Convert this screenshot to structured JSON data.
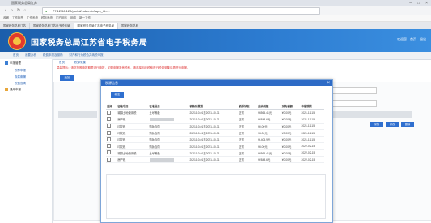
{
  "browser": {
    "window_title": "国家税务总局江苏",
    "url": "77.12.56.120/portal/index.do?app_id=...",
    "bookmarks": [
      "收藏",
      "工作标签",
      "工作系统",
      "税务系统",
      "门户网站",
      "网络",
      "新一工作"
    ],
    "tabs": [
      "国家税务总局江苏",
      "国家税务总局江苏电子税务局",
      "国家税务总局江苏电子税务局",
      "国家税务总局"
    ]
  },
  "header": {
    "site_title": "国家税务总局江苏省电子税务局",
    "right_links": [
      "欢迎您",
      "首页",
      "退出"
    ]
  },
  "nav": [
    "首页",
    "我要办税",
    "税费申报及缴纳",
    "财产和行为税合并纳税申报"
  ],
  "sidebar": {
    "items": [
      {
        "label": "申报管理"
      },
      {
        "label": "税种申报"
      },
      {
        "label": "合并申报"
      },
      {
        "label": "税费查询"
      },
      {
        "label": "通用申报"
      }
    ]
  },
  "subtabs": [
    "首页",
    "税源采集"
  ],
  "tip": "温馨提示：请您按照申报期限进行申报，如需申报其他税种，请选择相应税种进行税源采集后再进行申报。",
  "back_button": "返回",
  "bg_buttons": [
    "采集",
    "修改",
    "删除"
  ],
  "modal": {
    "title": "税源信息",
    "confirm_label": "确定",
    "columns": [
      "选择",
      "征收项目",
      "征收品目",
      "税款所属期",
      "税源状态",
      "应纳税额",
      "减免税额",
      "申报期限"
    ],
    "rows": [
      {
        "item": "城镇土地使用税",
        "sub": "土地等级",
        "period": "2021-10-01至2021-10-31",
        "status": "正常",
        "tax": "¥3564.41元",
        "relief": "¥0.00元",
        "deadline": "2021-11-15"
      },
      {
        "item": "房产税",
        "sub": "",
        "period": "2021-10-01至2021-10-31",
        "status": "正常",
        "tax": "¥2848.6元",
        "relief": "¥0.00元",
        "deadline": "2021-11-15"
      },
      {
        "item": "印花税",
        "sub": "购销合同",
        "period": "2021-10-01至2021-10-31",
        "status": "正常",
        "tax": "¥0.00元",
        "relief": "¥0.00元",
        "deadline": "2021-11-15"
      },
      {
        "item": "印花税",
        "sub": "购销合同",
        "period": "2021-10-01至2021-10-31",
        "status": "正常",
        "tax": "¥4.00元",
        "relief": "¥0.00元",
        "deadline": "2021-11-15"
      },
      {
        "item": "印花税",
        "sub": "购销合同",
        "period": "2021-10-01至2021-10-31",
        "status": "正常",
        "tax": "¥1405.9元",
        "relief": "¥0.00元",
        "deadline": "2021-11-15"
      },
      {
        "item": "印花税",
        "sub": "购销合同",
        "period": "2021-10-01至2021-10-31",
        "status": "正常",
        "tax": "¥3.00元",
        "relief": "¥0.00元",
        "deadline": "2022-02-15"
      },
      {
        "item": "城镇土地使用税",
        "sub": "土地等级",
        "period": "2021-10-01至2021-10-31",
        "status": "正常",
        "tax": "¥3564.41元",
        "relief": "¥0.00元",
        "deadline": "2022-02-15"
      },
      {
        "item": "房产税",
        "sub": "",
        "period": "2021-10-01至2021-10-31",
        "status": "正常",
        "tax": "¥2848.6元",
        "relief": "¥0.00元",
        "deadline": "2022-02-15"
      }
    ]
  }
}
